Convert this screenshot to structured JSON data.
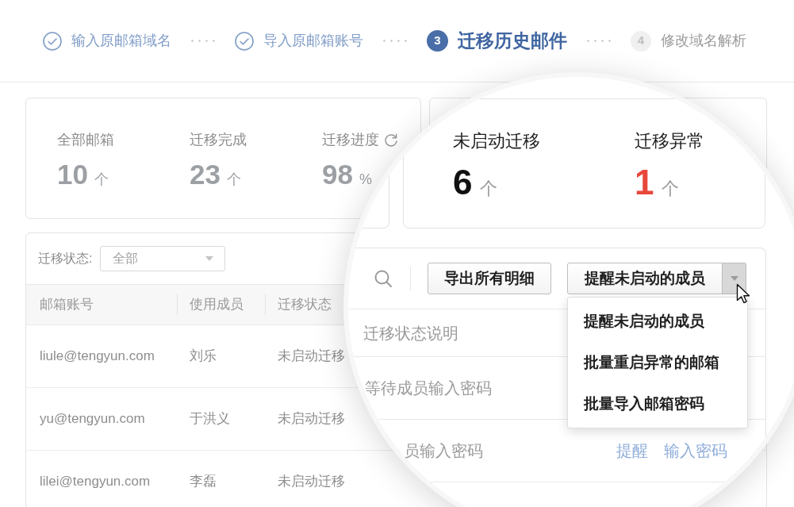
{
  "stepper": {
    "steps": [
      {
        "label": "输入原邮箱域名",
        "completed": true,
        "selected": false
      },
      {
        "label": "导入原邮箱账号",
        "completed": true,
        "selected": false
      },
      {
        "number": "3",
        "label": "迁移历史邮件",
        "completed": false,
        "selected": true
      },
      {
        "number": "4",
        "label": "修改域名解析",
        "completed": false,
        "selected": false
      }
    ]
  },
  "summary": {
    "stats": [
      {
        "label": "全部邮箱",
        "value": "10",
        "unit": "个",
        "refresh": false
      },
      {
        "label": "迁移完成",
        "value": "23",
        "unit": "个",
        "refresh": false
      },
      {
        "label": "迁移进度",
        "value": "98",
        "unit": "%",
        "refresh": true
      }
    ]
  },
  "table": {
    "filter": {
      "label": "迁移状态:",
      "value": "全部"
    },
    "columns": [
      "邮箱账号",
      "使用成员",
      "迁移状态"
    ],
    "rows": [
      {
        "cells": [
          "liule@tengyun.com",
          "刘乐",
          "未启动迁移"
        ]
      },
      {
        "cells": [
          "yu@tengyun.com",
          "于洪义",
          "未启动迁移"
        ]
      },
      {
        "cells": [
          "lilei@tengyun.com",
          "李磊",
          "未启动迁移"
        ]
      }
    ]
  },
  "magnifier": {
    "stats": [
      {
        "label": "未启动迁移",
        "value": "6",
        "unit": "个",
        "alert": false
      },
      {
        "label": "迁移异常",
        "value": "1",
        "unit": "个",
        "alert": true
      }
    ],
    "toolbar": {
      "export_button": "导出所有明细",
      "split_button": {
        "label": "提醒未启动的成员",
        "expanded": true
      }
    },
    "menu": [
      {
        "label": "提醒未启动的成员"
      },
      {
        "label": "批量重启异常的邮箱"
      },
      {
        "label": "批量导入邮箱密码"
      }
    ],
    "columns": [
      "迁移状态说明"
    ],
    "rows": [
      {
        "description": "等待成员输入密码"
      },
      {
        "description": "员输入密码",
        "actions": [
          "提醒",
          "输入密码"
        ]
      }
    ]
  }
}
